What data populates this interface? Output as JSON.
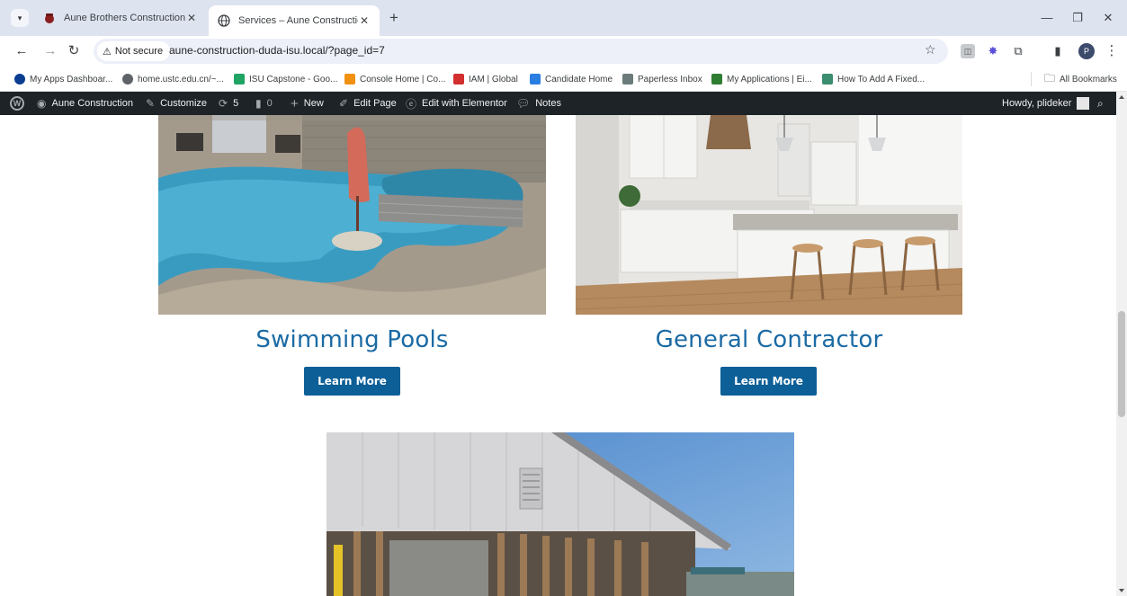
{
  "browser": {
    "tabs": [
      {
        "title": "Aune Brothers Construction",
        "active": false
      },
      {
        "title": "Services – Aune Construction",
        "active": true
      }
    ],
    "address": {
      "security_label": "Not secure",
      "url": "aune-construction-duda-isu.local/?page_id=7"
    },
    "profile_initial": "P",
    "bookmarks": [
      {
        "label": "My Apps Dashboar...",
        "icon_color": "#0a3d91"
      },
      {
        "label": "home.ustc.edu.cn/~...",
        "icon_color": "#5f6368"
      },
      {
        "label": "ISU Capstone - Goo...",
        "icon_color": "#1fa463"
      },
      {
        "label": "Console Home | Co...",
        "icon_color": "#f29111"
      },
      {
        "label": "IAM | Global",
        "icon_color": "#d32f2f"
      },
      {
        "label": "Candidate Home",
        "icon_color": "#2a7de1"
      },
      {
        "label": "Paperless Inbox",
        "icon_color": "#6b7b7b"
      },
      {
        "label": "My Applications | Ei...",
        "icon_color": "#2e7d32"
      },
      {
        "label": "How To Add A Fixed...",
        "icon_color": "#3a8d6e"
      }
    ],
    "all_bookmarks_label": "All Bookmarks"
  },
  "adminbar": {
    "site_name": "Aune Construction",
    "customize": "Customize",
    "updates_count": "5",
    "comments_count": "0",
    "new": "New",
    "edit_page": "Edit Page",
    "edit_elementor": "Edit with Elementor",
    "notes": "Notes",
    "howdy": "Howdy, plideker"
  },
  "services": [
    {
      "title": "Swimming Pools",
      "button": "Learn More"
    },
    {
      "title": "General Contractor",
      "button": "Learn More"
    }
  ],
  "colors": {
    "title_blue": "#1b6aa4",
    "button_blue": "#0d5f97",
    "adminbar": "#1d2327"
  }
}
